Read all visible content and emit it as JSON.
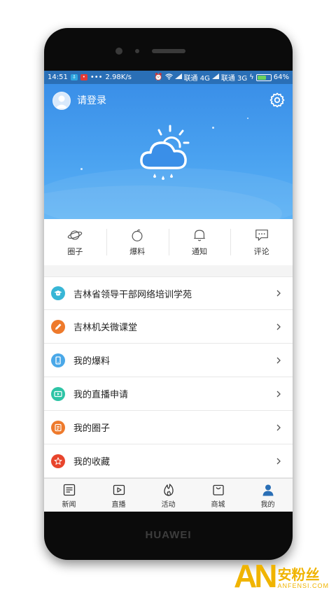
{
  "status_bar": {
    "time": "14:51",
    "speed": "2.98K/s",
    "carrier1": "联通 4G",
    "carrier2": "联通 3G",
    "battery": "64%",
    "battery_level": 0.64
  },
  "profile": {
    "login_label": "请登录"
  },
  "quick_actions": [
    {
      "label": "圈子",
      "icon": "planet-icon"
    },
    {
      "label": "爆料",
      "icon": "bomb-icon"
    },
    {
      "label": "通知",
      "icon": "bell-icon"
    },
    {
      "label": "评论",
      "icon": "comment-icon"
    }
  ],
  "menu": [
    {
      "label": "吉林省领导干部网络培训学苑",
      "icon": "graduation-cap-icon",
      "color": "#38b6d6"
    },
    {
      "label": "吉林机关微课堂",
      "icon": "pencil-icon",
      "color": "#ee7a2c"
    },
    {
      "label": "我的爆料",
      "icon": "phone-icon",
      "color": "#4aa8e8"
    },
    {
      "label": "我的直播申请",
      "icon": "video-icon",
      "color": "#2ec4a6"
    },
    {
      "label": "我的圈子",
      "icon": "note-icon",
      "color": "#ee7a2c"
    },
    {
      "label": "我的收藏",
      "icon": "star-icon",
      "color": "#e8452c"
    }
  ],
  "tabs": [
    {
      "label": "新闻",
      "icon": "news-icon"
    },
    {
      "label": "直播",
      "icon": "live-icon"
    },
    {
      "label": "活动",
      "icon": "fire-icon"
    },
    {
      "label": "商城",
      "icon": "shop-icon"
    },
    {
      "label": "我的",
      "icon": "person-icon",
      "active": true
    }
  ],
  "device": {
    "brand": "HUAWEI"
  },
  "watermark": {
    "logo": "AN",
    "cn": "安粉丝",
    "en": "ANFENSI.COM"
  },
  "colors": {
    "header_blue": "#3a8fe8",
    "status_bar": "#2a6fb6",
    "active_tab": "#2a6fb6"
  }
}
